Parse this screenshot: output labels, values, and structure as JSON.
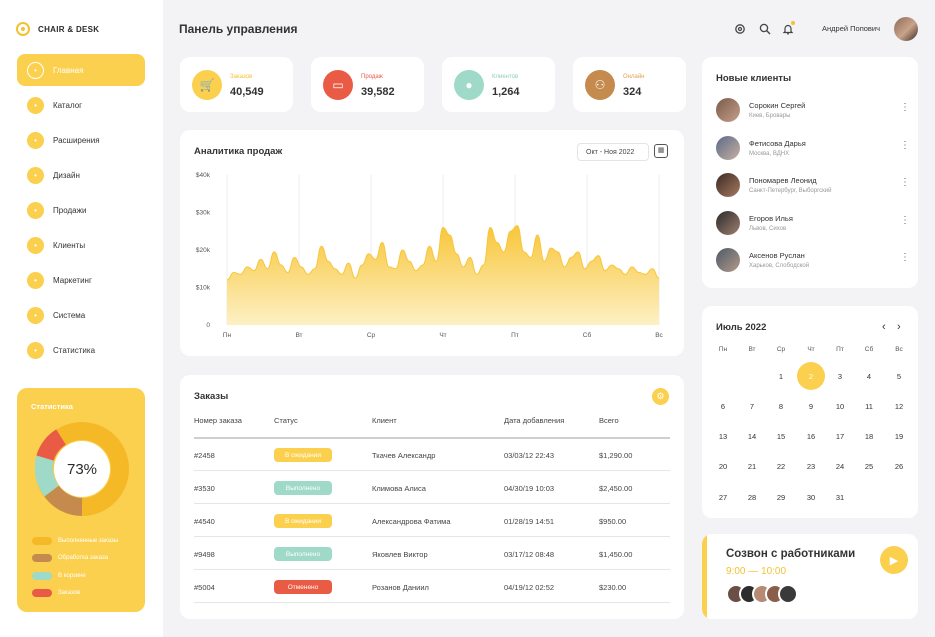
{
  "brand": {
    "name": "CHAIR & DESK"
  },
  "sidebar": {
    "items": [
      {
        "label": "Главная",
        "icon": "home-icon",
        "active": true
      },
      {
        "label": "Каталог",
        "icon": "catalog-icon"
      },
      {
        "label": "Расширения",
        "icon": "extensions-icon"
      },
      {
        "label": "Дизайн",
        "icon": "design-icon"
      },
      {
        "label": "Продажи",
        "icon": "cart-icon"
      },
      {
        "label": "Клиенты",
        "icon": "user-icon"
      },
      {
        "label": "Маркетинг",
        "icon": "marketing-icon"
      },
      {
        "label": "Система",
        "icon": "system-icon"
      },
      {
        "label": "Статистика",
        "icon": "statistics-icon"
      }
    ]
  },
  "stats": {
    "title": "Статистика",
    "percent": "73%",
    "legend": [
      {
        "label": "Выполненные заказы",
        "color": "#f5b928"
      },
      {
        "label": "Обработка заказа",
        "color": "#c58a4e"
      },
      {
        "label": "В корзине",
        "color": "#9fd9c8"
      },
      {
        "label": "Заказов",
        "color": "#ea5b45"
      }
    ]
  },
  "header": {
    "title": "Панель управления",
    "user_name": "Андрей Попович"
  },
  "kpis": [
    {
      "label": "Заказов",
      "value": "40,549",
      "color": "#fbd04e",
      "label_color": "#f2c230",
      "icon": "cart-icon"
    },
    {
      "label": "Продаж",
      "value": "39,582",
      "color": "#ea5b45",
      "label_color": "#ea5b45",
      "icon": "wallet-icon"
    },
    {
      "label": "Клиентов",
      "value": "1,264",
      "color": "#9fd9c8",
      "label_color": "#8ccdbb",
      "icon": "user-icon"
    },
    {
      "label": "Онлайн",
      "value": "324",
      "color": "#c58a4e",
      "label_color": "#e3a24e",
      "icon": "group-icon"
    }
  ],
  "analytics": {
    "title": "Аналитика продаж",
    "date_range": "Окт - Ноя 2022"
  },
  "chart_data": {
    "type": "area",
    "title": "Аналитика продаж",
    "y_ticks": [
      "$40k",
      "$30k",
      "$20k",
      "$10k",
      "0"
    ],
    "x_ticks": [
      "Пн",
      "Вт",
      "Ср",
      "Чт",
      "Пт",
      "Сб",
      "Вс"
    ],
    "ylim": [
      0,
      40000
    ],
    "color": "#f8c63a",
    "values": [
      12000,
      14000,
      13500,
      15500,
      14500,
      17500,
      15000,
      19500,
      16000,
      14000,
      18000,
      15500,
      13500,
      15000,
      21000,
      17000,
      15000,
      13500,
      16500,
      12500,
      16000,
      19000,
      17500,
      22000,
      15500,
      15000,
      20000,
      17000,
      14500,
      16000,
      21000,
      17000,
      26000,
      24000,
      19000,
      15500,
      18000,
      13500,
      16000,
      26000,
      22000,
      19500,
      25000,
      26500,
      19500,
      18000,
      24000,
      17000,
      20500,
      19500,
      15500,
      18000,
      19500,
      15000,
      17000,
      18500,
      14500,
      16000,
      15000,
      13500,
      15500,
      14000,
      13500,
      15000,
      12500
    ]
  },
  "orders": {
    "title": "Заказы",
    "columns": [
      "Номер заказа",
      "Статус",
      "Клиент",
      "Дата добавления",
      "Всего"
    ],
    "rows": [
      {
        "id": "#2458",
        "status": "В ожидании",
        "status_color": "#fbd04e",
        "client": "Ткачев Александр",
        "date": "03/03/12 22:43",
        "total": "$1,290.00"
      },
      {
        "id": "#3530",
        "status": "Выполнено",
        "status_color": "#9fd9c8",
        "client": "Климова Алиса",
        "date": "04/30/19 10:03",
        "total": "$2,450.00"
      },
      {
        "id": "#4540",
        "status": "В ожидании",
        "status_color": "#fbd04e",
        "client": "Александрова Фатима",
        "date": "01/28/19 14:51",
        "total": "$950.00"
      },
      {
        "id": "#9498",
        "status": "Выполнено",
        "status_color": "#9fd9c8",
        "client": "Яковлев Виктор",
        "date": "03/17/12 08:48",
        "total": "$1,450.00"
      },
      {
        "id": "#5004",
        "status": "Отменено",
        "status_color": "#ea5b45",
        "client": "Розанов Даниил",
        "date": "04/19/12 02:52",
        "total": "$230.00"
      }
    ]
  },
  "new_clients": {
    "title": "Новые клиенты",
    "items": [
      {
        "name": "Сорокин Сергей",
        "location": "Киев, Бровары"
      },
      {
        "name": "Фетисова Дарья",
        "location": "Москва, ВДНХ"
      },
      {
        "name": "Пономарев Леонид",
        "location": "Санкт-Петербург, Выборгский"
      },
      {
        "name": "Егоров Илья",
        "location": "Львов, Сихов"
      },
      {
        "name": "Аксенов Руслан",
        "location": "Харьков, Слободской"
      }
    ]
  },
  "calendar": {
    "title": "Июль 2022",
    "dows": [
      "Пн",
      "Вт",
      "Ср",
      "Чт",
      "Пт",
      "Сб",
      "Вс"
    ],
    "selected": "2",
    "weeks": [
      [
        "",
        "",
        "1",
        "2",
        "3",
        "4",
        "5"
      ],
      [
        "6",
        "7",
        "8",
        "9",
        "10",
        "11",
        "12"
      ],
      [
        "13",
        "14",
        "15",
        "16",
        "17",
        "18",
        "19"
      ],
      [
        "20",
        "21",
        "22",
        "23",
        "24",
        "25",
        "26"
      ],
      [
        "27",
        "28",
        "29",
        "30",
        "31",
        "",
        ""
      ]
    ]
  },
  "call": {
    "title": "Созвон с работниками",
    "time": "9:00 — 10:00"
  }
}
